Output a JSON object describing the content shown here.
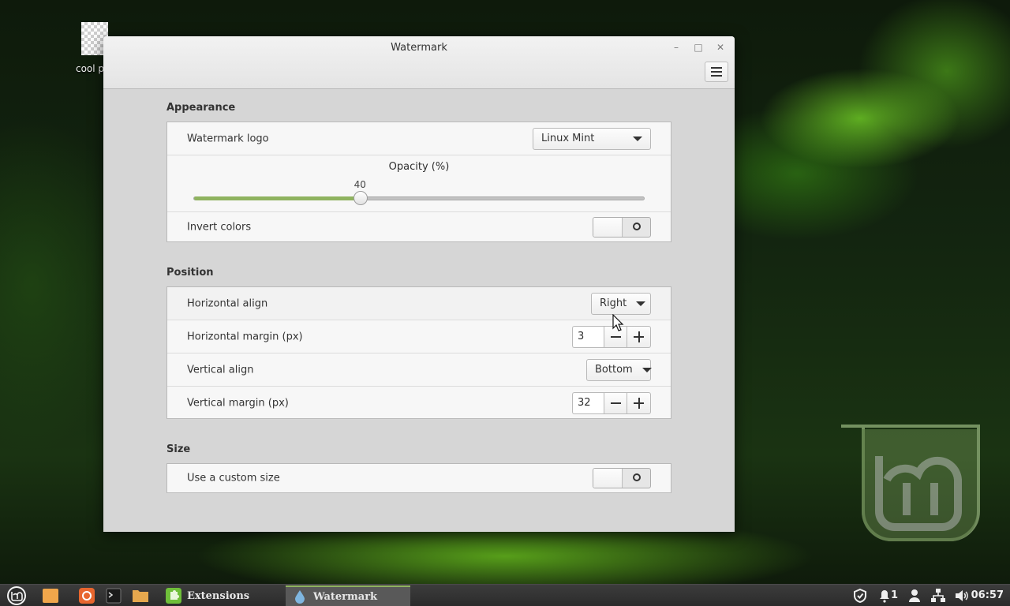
{
  "desktop": {
    "icon_label": "cool pro"
  },
  "window": {
    "title": "Watermark",
    "minimize_label": "–",
    "maximize_label": "□",
    "close_label": "✕"
  },
  "appearance": {
    "section_title": "Appearance",
    "watermark_logo_label": "Watermark logo",
    "watermark_logo_value": "Linux Mint",
    "opacity_label": "Opacity (%)",
    "opacity_value": "40",
    "opacity_fraction": 0.37,
    "invert_colors_label": "Invert colors",
    "invert_colors_on": false
  },
  "position": {
    "section_title": "Position",
    "horizontal_align_label": "Horizontal align",
    "horizontal_align_value": "Right",
    "horizontal_margin_label": "Horizontal margin (px)",
    "horizontal_margin_value": "3",
    "vertical_align_label": "Vertical align",
    "vertical_align_value": "Bottom",
    "vertical_margin_label": "Vertical margin (px)",
    "vertical_margin_value": "32"
  },
  "size": {
    "section_title": "Size",
    "custom_size_label": "Use a custom size",
    "custom_size_on": false
  },
  "taskbar": {
    "tasks": [
      {
        "label": "Extensions",
        "icon": "puzzle-icon",
        "color": "#6fbf3a"
      },
      {
        "label": "Watermark",
        "icon": "water-drop-icon",
        "color": "#7fb6e0",
        "active": true
      }
    ],
    "notification_count": "1",
    "clock": "06:57"
  },
  "colors": {
    "accent": "#8fb35f"
  }
}
